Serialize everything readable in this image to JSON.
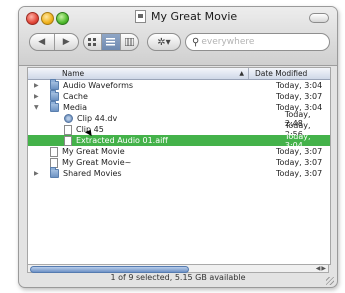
{
  "window": {
    "title": "My Great Movie"
  },
  "toolbar": {
    "back_glyph": "◀",
    "forward_glyph": "▶",
    "action_glyph": "✲▾",
    "search_placeholder": "everywhere"
  },
  "columns": {
    "name": "Name",
    "date": "Date Modified"
  },
  "rows": [
    {
      "name": "Audio Waveforms",
      "date": "Today, 3:04",
      "type": "folder",
      "level": 0,
      "disclosure": "collapsed"
    },
    {
      "name": "Cache",
      "date": "Today, 3:07",
      "type": "folder",
      "level": 0,
      "disclosure": "collapsed"
    },
    {
      "name": "Media",
      "date": "Today, 3:04",
      "type": "folder",
      "level": 0,
      "disclosure": "expanded"
    },
    {
      "name": "Clip 44.dv",
      "date": "Today, 2:48",
      "type": "movie",
      "level": 1
    },
    {
      "name": "Clip 45",
      "date": "Today, 2:56",
      "type": "doc",
      "level": 1
    },
    {
      "name": "Extracted Audio 01.aiff",
      "date": "Today, 3:04",
      "type": "doc",
      "level": 1,
      "selected": true
    },
    {
      "name": "My Great Movie",
      "date": "Today, 3:07",
      "type": "doc",
      "level": 0
    },
    {
      "name": "My Great Movie~",
      "date": "Today, 3:07",
      "type": "doc",
      "level": 0
    },
    {
      "name": "Shared Movies",
      "date": "Today, 3:07",
      "type": "folder",
      "level": 0,
      "disclosure": "collapsed"
    }
  ],
  "status": "1 of 9 selected, 5.15 GB available",
  "colors": {
    "selection": "#44b24a",
    "header": "#cfd8e8"
  }
}
